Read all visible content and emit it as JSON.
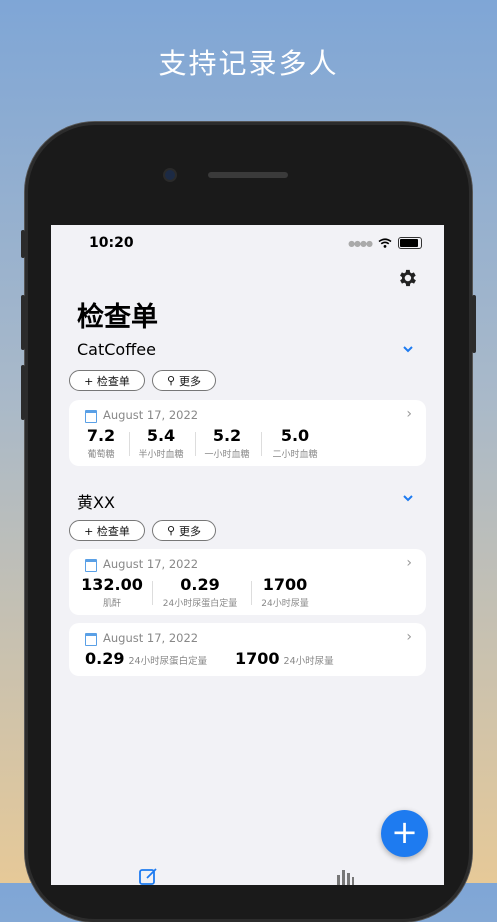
{
  "headline": "支持记录多人",
  "status": {
    "time": "10:20"
  },
  "page_title": "检查单",
  "accent_color": "#1e7bf0",
  "groups": [
    {
      "name": "CatCoffee",
      "add_label": "+ 检查单",
      "more_label": "更多",
      "records": [
        {
          "date": "August 17, 2022",
          "metrics": [
            {
              "value": "7.2",
              "label": "葡萄糖"
            },
            {
              "value": "5.4",
              "label": "半小时血糖"
            },
            {
              "value": "5.2",
              "label": "一小时血糖"
            },
            {
              "value": "5.0",
              "label": "二小时血糖"
            }
          ]
        }
      ]
    },
    {
      "name": "黄XX",
      "add_label": "+ 检查单",
      "more_label": "更多",
      "records": [
        {
          "date": "August 17, 2022",
          "metrics": [
            {
              "value": "132.00",
              "label": "肌酐"
            },
            {
              "value": "0.29",
              "label": "24小时尿蛋白定量"
            },
            {
              "value": "1700",
              "label": "24小时尿量"
            }
          ]
        },
        {
          "date": "August 17, 2022",
          "metrics": [
            {
              "value": "0.29",
              "label": "24小时尿蛋白定量"
            },
            {
              "value": "1700",
              "label": "24小时尿量"
            }
          ]
        }
      ]
    }
  ],
  "fab_label": "+",
  "tabs": [
    {
      "icon": "edit-icon",
      "active": true
    },
    {
      "icon": "chart-icon",
      "active": false
    }
  ]
}
